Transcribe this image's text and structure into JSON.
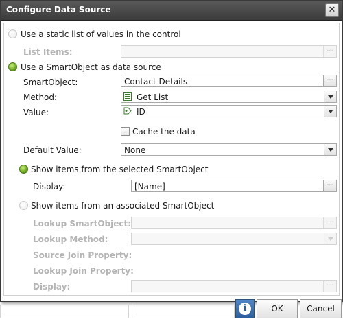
{
  "dialog": {
    "title": "Configure Data Source",
    "close_glyph": "✕"
  },
  "static_list": {
    "radio_label": "Use a static list of values in the control",
    "list_items_label": "List Items:",
    "list_items_value": "",
    "selected": false
  },
  "smartobject_source": {
    "radio_label": "Use a SmartObject as data source",
    "selected": true
  },
  "fields": {
    "smartobject": {
      "label": "SmartObject:",
      "value": "Contact Details"
    },
    "method": {
      "label": "Method:",
      "value": "Get List",
      "icon": "list-method-icon"
    },
    "value": {
      "label": "Value:",
      "value": "ID",
      "icon": "property-icon"
    }
  },
  "cache": {
    "label": "Cache the data",
    "checked": false
  },
  "default_value": {
    "label": "Default Value:",
    "value": "None"
  },
  "show_selected": {
    "radio_label": "Show items from the selected SmartObject",
    "selected": true,
    "display_label": "Display:",
    "display_value": "[Name]"
  },
  "show_associated": {
    "radio_label": "Show items from an associated SmartObject",
    "selected": false,
    "lookup_smartobject_label": "Lookup SmartObject:",
    "lookup_method_label": "Lookup Method:",
    "source_join_label": "Source Join Property:",
    "lookup_join_label": "Lookup Join Property:",
    "display_label": "Display:"
  },
  "footer": {
    "info_glyph": "i",
    "ok_label": "OK",
    "cancel_label": "Cancel"
  },
  "ellipsis": "..."
}
